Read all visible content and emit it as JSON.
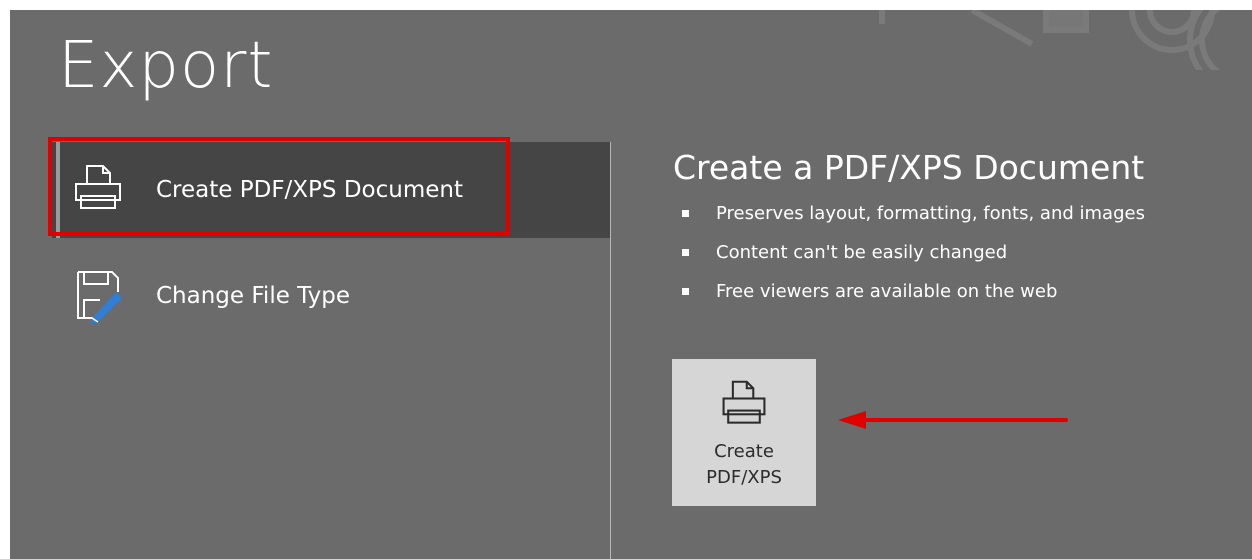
{
  "page": {
    "title": "Export"
  },
  "nav": {
    "items": [
      {
        "label": "Create PDF/XPS Document",
        "icon": "pdf-printer-icon",
        "selected": true
      },
      {
        "label": "Change File Type",
        "icon": "change-file-type-icon",
        "selected": false
      }
    ]
  },
  "detail": {
    "heading": "Create a PDF/XPS Document",
    "bullets": [
      "Preserves layout, formatting, fonts, and images",
      "Content can't be easily changed",
      "Free viewers are available on the web"
    ],
    "button": {
      "label": "Create\nPDF/XPS",
      "icon": "pdf-printer-icon"
    }
  },
  "colors": {
    "background": "#6b6b6b",
    "selected_item": "#454545",
    "button_face": "#d6d6d6",
    "annotation_red": "#e00000",
    "pencil_blue": "#2f7fd6"
  }
}
